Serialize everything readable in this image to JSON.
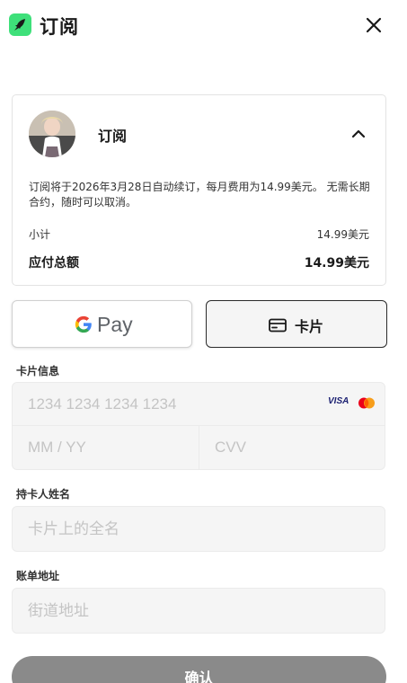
{
  "header": {
    "title": "订阅",
    "close_icon": "close-icon",
    "logo_color": "#3ee07a"
  },
  "summary": {
    "name": "订阅",
    "description": "订阅将于2026年3月28日自动续订，每月费用为14.99美元。 无需长期合约，随时可以取消。",
    "subtotal_label": "小计",
    "subtotal_value": "14.99美元",
    "total_label": "应付总额",
    "total_value": "14.99美元"
  },
  "payment_methods": {
    "gpay_label": "Pay",
    "card_label": "卡片"
  },
  "card_info": {
    "label": "卡片信息",
    "number_placeholder": "1234 1234 1234 1234",
    "expiry_placeholder": "MM / YY",
    "cvv_placeholder": "CVV",
    "brands": [
      "VISA",
      "mastercard"
    ]
  },
  "cardholder": {
    "label": "持卡人姓名",
    "placeholder": "卡片上的全名"
  },
  "billing": {
    "label": "账单地址",
    "placeholder": "街道地址"
  },
  "confirm": {
    "label": "确认",
    "color": "#8a8a8a"
  }
}
